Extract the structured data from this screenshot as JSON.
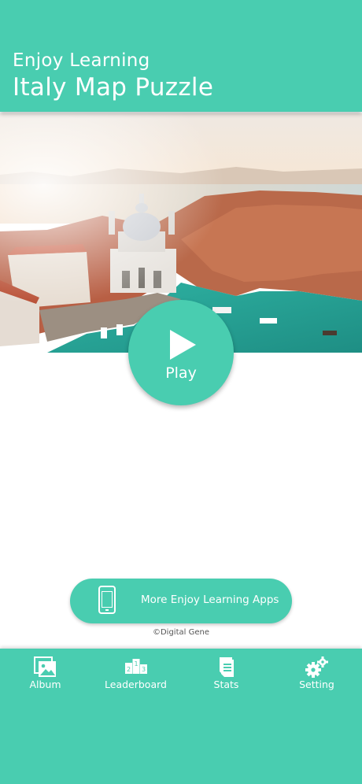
{
  "header": {
    "subtitle": "Enjoy Learning",
    "title": "Italy Map Puzzle"
  },
  "hero": {
    "image": "aerial-photo-venice-santa-maria-della-salute"
  },
  "play_button": {
    "label": "Play",
    "icon": "play-triangle-icon"
  },
  "more_apps": {
    "label": "More Enjoy Learning Apps",
    "icon": "phone-icon"
  },
  "copyright": "©Digital Gene",
  "tabbar": {
    "items": [
      {
        "label": "Album",
        "icon": "album-icon"
      },
      {
        "label": "Leaderboard",
        "icon": "podium-icon"
      },
      {
        "label": "Stats",
        "icon": "document-icon"
      },
      {
        "label": "Setting",
        "icon": "gears-icon"
      }
    ]
  },
  "colors": {
    "accent": "#49cdb0",
    "text_on_accent": "#ffffff",
    "copyright_text": "#555555"
  }
}
